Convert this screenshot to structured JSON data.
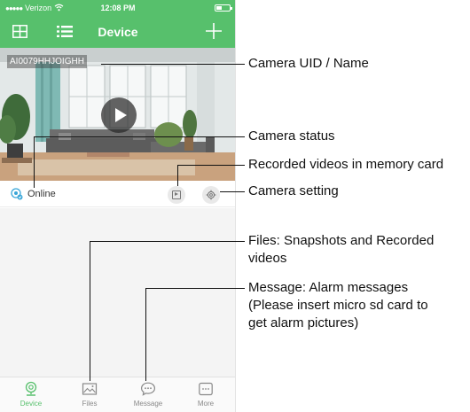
{
  "status_bar": {
    "signal_dots": "●●●●●",
    "carrier": "Verizon",
    "time": "12:08 PM"
  },
  "nav": {
    "title": "Device",
    "icons": [
      "grid-icon",
      "list-icon",
      "add-icon"
    ]
  },
  "camera": {
    "uid_label": "AI0079HHJOIGHH",
    "status": "Online"
  },
  "tabs": [
    {
      "label": "Device",
      "icon": "webcam-icon",
      "active": true
    },
    {
      "label": "Files",
      "icon": "image-icon",
      "active": false
    },
    {
      "label": "Message",
      "icon": "chat-bubble-icon",
      "active": false
    },
    {
      "label": "More",
      "icon": "more-icon",
      "active": false
    }
  ],
  "annotations": {
    "uid": "Camera UID / Name",
    "status": "Camera status",
    "recorded": "Recorded videos in memory card",
    "setting": "Camera setting",
    "files_line1": "Files: Snapshots and Recorded",
    "files_line2": "videos",
    "message_line1": "Message: Alarm messages",
    "message_line2": "(Please insert micro sd card to",
    "message_line3": "get alarm pictures)"
  },
  "colors": {
    "accent": "#57c06c",
    "background": "#f4f4f4"
  }
}
